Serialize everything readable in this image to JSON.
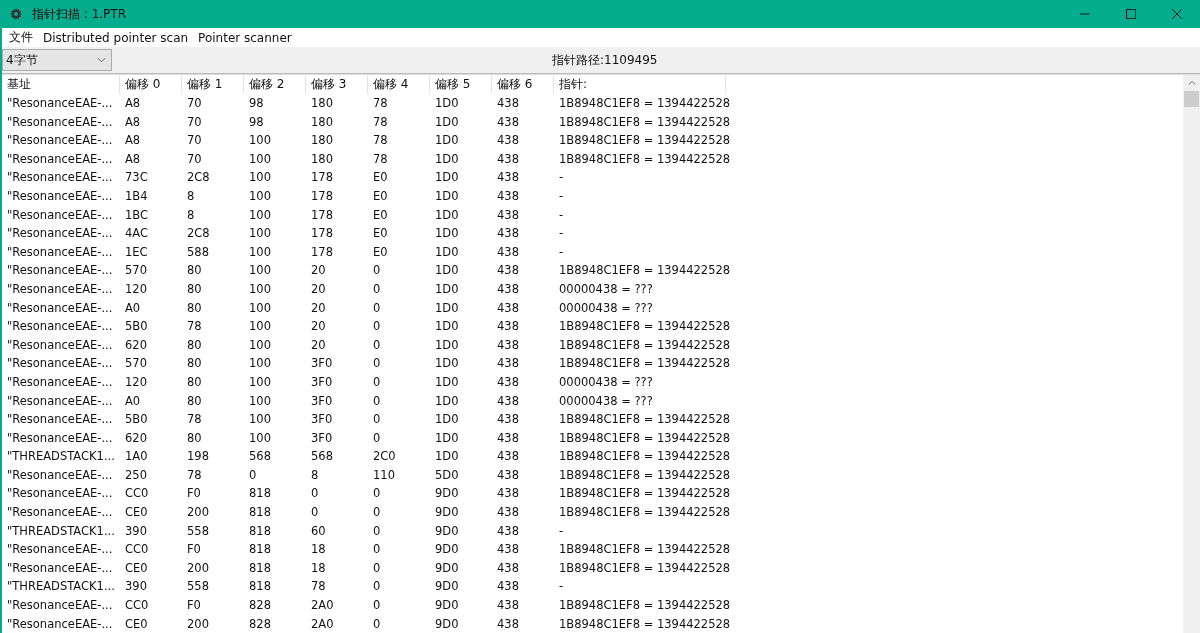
{
  "window": {
    "title": "指针扫描 : 1.PTR"
  },
  "menu": [
    "文件",
    "Distributed pointer scan",
    "Pointer scanner"
  ],
  "toolbar": {
    "dropdown": "4字节",
    "path_count": "指针路径:1109495"
  },
  "table": {
    "columns": [
      "基址",
      "偏移 0",
      "偏移 1",
      "偏移 2",
      "偏移 3",
      "偏移 4",
      "偏移 5",
      "偏移 6",
      "指针:"
    ],
    "rows": [
      [
        "\"ResonanceEAE-...",
        "A8",
        "70",
        "98",
        "180",
        "78",
        "1D0",
        "438",
        "1B8948C1EF8 = 1394422528"
      ],
      [
        "\"ResonanceEAE-...",
        "A8",
        "70",
        "98",
        "180",
        "78",
        "1D0",
        "438",
        "1B8948C1EF8 = 1394422528"
      ],
      [
        "\"ResonanceEAE-...",
        "A8",
        "70",
        "100",
        "180",
        "78",
        "1D0",
        "438",
        "1B8948C1EF8 = 1394422528"
      ],
      [
        "\"ResonanceEAE-...",
        "A8",
        "70",
        "100",
        "180",
        "78",
        "1D0",
        "438",
        "1B8948C1EF8 = 1394422528"
      ],
      [
        "\"ResonanceEAE-...",
        "73C",
        "2C8",
        "100",
        "178",
        "E0",
        "1D0",
        "438",
        "-"
      ],
      [
        "\"ResonanceEAE-...",
        "1B4",
        "8",
        "100",
        "178",
        "E0",
        "1D0",
        "438",
        "-"
      ],
      [
        "\"ResonanceEAE-...",
        "1BC",
        "8",
        "100",
        "178",
        "E0",
        "1D0",
        "438",
        "-"
      ],
      [
        "\"ResonanceEAE-...",
        "4AC",
        "2C8",
        "100",
        "178",
        "E0",
        "1D0",
        "438",
        "-"
      ],
      [
        "\"ResonanceEAE-...",
        "1EC",
        "588",
        "100",
        "178",
        "E0",
        "1D0",
        "438",
        "-"
      ],
      [
        "\"ResonanceEAE-...",
        "570",
        "80",
        "100",
        "20",
        "0",
        "1D0",
        "438",
        "1B8948C1EF8 = 1394422528"
      ],
      [
        "\"ResonanceEAE-...",
        "120",
        "80",
        "100",
        "20",
        "0",
        "1D0",
        "438",
        "00000438 = ???"
      ],
      [
        "\"ResonanceEAE-...",
        "A0",
        "80",
        "100",
        "20",
        "0",
        "1D0",
        "438",
        "00000438 = ???"
      ],
      [
        "\"ResonanceEAE-...",
        "5B0",
        "78",
        "100",
        "20",
        "0",
        "1D0",
        "438",
        "1B8948C1EF8 = 1394422528"
      ],
      [
        "\"ResonanceEAE-...",
        "620",
        "80",
        "100",
        "20",
        "0",
        "1D0",
        "438",
        "1B8948C1EF8 = 1394422528"
      ],
      [
        "\"ResonanceEAE-...",
        "570",
        "80",
        "100",
        "3F0",
        "0",
        "1D0",
        "438",
        "1B8948C1EF8 = 1394422528"
      ],
      [
        "\"ResonanceEAE-...",
        "120",
        "80",
        "100",
        "3F0",
        "0",
        "1D0",
        "438",
        "00000438 = ???"
      ],
      [
        "\"ResonanceEAE-...",
        "A0",
        "80",
        "100",
        "3F0",
        "0",
        "1D0",
        "438",
        "00000438 = ???"
      ],
      [
        "\"ResonanceEAE-...",
        "5B0",
        "78",
        "100",
        "3F0",
        "0",
        "1D0",
        "438",
        "1B8948C1EF8 = 1394422528"
      ],
      [
        "\"ResonanceEAE-...",
        "620",
        "80",
        "100",
        "3F0",
        "0",
        "1D0",
        "438",
        "1B8948C1EF8 = 1394422528"
      ],
      [
        "\"THREADSTACK1...",
        "1A0",
        "198",
        "568",
        "568",
        "2C0",
        "1D0",
        "438",
        "1B8948C1EF8 = 1394422528"
      ],
      [
        "\"ResonanceEAE-...",
        "250",
        "78",
        "0",
        "8",
        "110",
        "5D0",
        "438",
        "1B8948C1EF8 = 1394422528"
      ],
      [
        "\"ResonanceEAE-...",
        "CC0",
        "F0",
        "818",
        "0",
        "0",
        "9D0",
        "438",
        "1B8948C1EF8 = 1394422528"
      ],
      [
        "\"ResonanceEAE-...",
        "CE0",
        "200",
        "818",
        "0",
        "0",
        "9D0",
        "438",
        "1B8948C1EF8 = 1394422528"
      ],
      [
        "\"THREADSTACK1...",
        "390",
        "558",
        "818",
        "60",
        "0",
        "9D0",
        "438",
        "-"
      ],
      [
        "\"ResonanceEAE-...",
        "CC0",
        "F0",
        "818",
        "18",
        "0",
        "9D0",
        "438",
        "1B8948C1EF8 = 1394422528"
      ],
      [
        "\"ResonanceEAE-...",
        "CE0",
        "200",
        "818",
        "18",
        "0",
        "9D0",
        "438",
        "1B8948C1EF8 = 1394422528"
      ],
      [
        "\"THREADSTACK1...",
        "390",
        "558",
        "818",
        "78",
        "0",
        "9D0",
        "438",
        "-"
      ],
      [
        "\"ResonanceEAE-...",
        "CC0",
        "F0",
        "828",
        "2A0",
        "0",
        "9D0",
        "438",
        "1B8948C1EF8 = 1394422528"
      ],
      [
        "\"ResonanceEAE-...",
        "CE0",
        "200",
        "828",
        "2A0",
        "0",
        "9D0",
        "438",
        "1B8948C1EF8 = 1394422528"
      ]
    ]
  }
}
